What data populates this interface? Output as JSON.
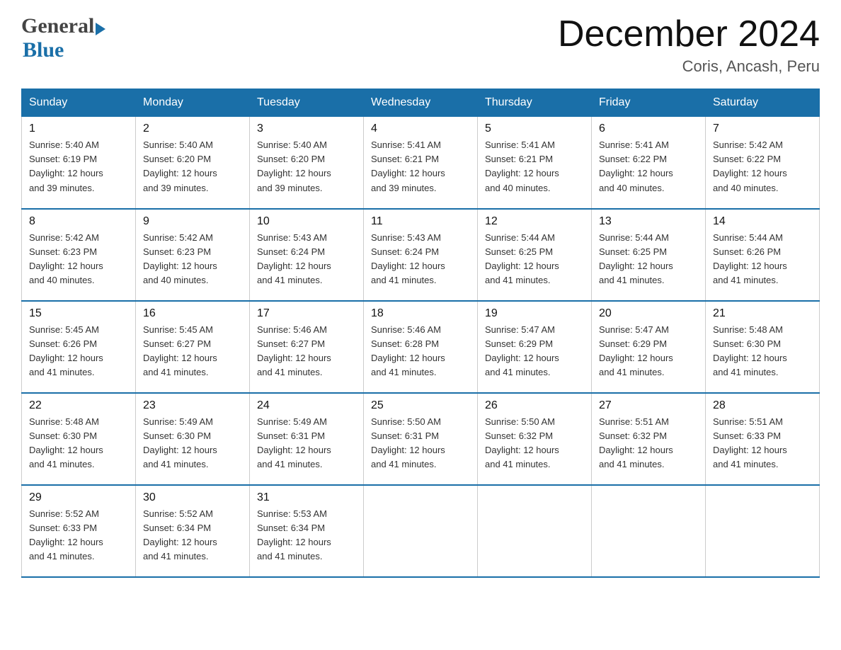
{
  "header": {
    "title": "December 2024",
    "location": "Coris, Ancash, Peru",
    "logo_general": "General",
    "logo_blue": "Blue"
  },
  "days_of_week": [
    "Sunday",
    "Monday",
    "Tuesday",
    "Wednesday",
    "Thursday",
    "Friday",
    "Saturday"
  ],
  "weeks": [
    [
      {
        "day": "1",
        "sunrise": "5:40 AM",
        "sunset": "6:19 PM",
        "daylight": "12 hours and 39 minutes."
      },
      {
        "day": "2",
        "sunrise": "5:40 AM",
        "sunset": "6:20 PM",
        "daylight": "12 hours and 39 minutes."
      },
      {
        "day": "3",
        "sunrise": "5:40 AM",
        "sunset": "6:20 PM",
        "daylight": "12 hours and 39 minutes."
      },
      {
        "day": "4",
        "sunrise": "5:41 AM",
        "sunset": "6:21 PM",
        "daylight": "12 hours and 39 minutes."
      },
      {
        "day": "5",
        "sunrise": "5:41 AM",
        "sunset": "6:21 PM",
        "daylight": "12 hours and 40 minutes."
      },
      {
        "day": "6",
        "sunrise": "5:41 AM",
        "sunset": "6:22 PM",
        "daylight": "12 hours and 40 minutes."
      },
      {
        "day": "7",
        "sunrise": "5:42 AM",
        "sunset": "6:22 PM",
        "daylight": "12 hours and 40 minutes."
      }
    ],
    [
      {
        "day": "8",
        "sunrise": "5:42 AM",
        "sunset": "6:23 PM",
        "daylight": "12 hours and 40 minutes."
      },
      {
        "day": "9",
        "sunrise": "5:42 AM",
        "sunset": "6:23 PM",
        "daylight": "12 hours and 40 minutes."
      },
      {
        "day": "10",
        "sunrise": "5:43 AM",
        "sunset": "6:24 PM",
        "daylight": "12 hours and 41 minutes."
      },
      {
        "day": "11",
        "sunrise": "5:43 AM",
        "sunset": "6:24 PM",
        "daylight": "12 hours and 41 minutes."
      },
      {
        "day": "12",
        "sunrise": "5:44 AM",
        "sunset": "6:25 PM",
        "daylight": "12 hours and 41 minutes."
      },
      {
        "day": "13",
        "sunrise": "5:44 AM",
        "sunset": "6:25 PM",
        "daylight": "12 hours and 41 minutes."
      },
      {
        "day": "14",
        "sunrise": "5:44 AM",
        "sunset": "6:26 PM",
        "daylight": "12 hours and 41 minutes."
      }
    ],
    [
      {
        "day": "15",
        "sunrise": "5:45 AM",
        "sunset": "6:26 PM",
        "daylight": "12 hours and 41 minutes."
      },
      {
        "day": "16",
        "sunrise": "5:45 AM",
        "sunset": "6:27 PM",
        "daylight": "12 hours and 41 minutes."
      },
      {
        "day": "17",
        "sunrise": "5:46 AM",
        "sunset": "6:27 PM",
        "daylight": "12 hours and 41 minutes."
      },
      {
        "day": "18",
        "sunrise": "5:46 AM",
        "sunset": "6:28 PM",
        "daylight": "12 hours and 41 minutes."
      },
      {
        "day": "19",
        "sunrise": "5:47 AM",
        "sunset": "6:29 PM",
        "daylight": "12 hours and 41 minutes."
      },
      {
        "day": "20",
        "sunrise": "5:47 AM",
        "sunset": "6:29 PM",
        "daylight": "12 hours and 41 minutes."
      },
      {
        "day": "21",
        "sunrise": "5:48 AM",
        "sunset": "6:30 PM",
        "daylight": "12 hours and 41 minutes."
      }
    ],
    [
      {
        "day": "22",
        "sunrise": "5:48 AM",
        "sunset": "6:30 PM",
        "daylight": "12 hours and 41 minutes."
      },
      {
        "day": "23",
        "sunrise": "5:49 AM",
        "sunset": "6:30 PM",
        "daylight": "12 hours and 41 minutes."
      },
      {
        "day": "24",
        "sunrise": "5:49 AM",
        "sunset": "6:31 PM",
        "daylight": "12 hours and 41 minutes."
      },
      {
        "day": "25",
        "sunrise": "5:50 AM",
        "sunset": "6:31 PM",
        "daylight": "12 hours and 41 minutes."
      },
      {
        "day": "26",
        "sunrise": "5:50 AM",
        "sunset": "6:32 PM",
        "daylight": "12 hours and 41 minutes."
      },
      {
        "day": "27",
        "sunrise": "5:51 AM",
        "sunset": "6:32 PM",
        "daylight": "12 hours and 41 minutes."
      },
      {
        "day": "28",
        "sunrise": "5:51 AM",
        "sunset": "6:33 PM",
        "daylight": "12 hours and 41 minutes."
      }
    ],
    [
      {
        "day": "29",
        "sunrise": "5:52 AM",
        "sunset": "6:33 PM",
        "daylight": "12 hours and 41 minutes."
      },
      {
        "day": "30",
        "sunrise": "5:52 AM",
        "sunset": "6:34 PM",
        "daylight": "12 hours and 41 minutes."
      },
      {
        "day": "31",
        "sunrise": "5:53 AM",
        "sunset": "6:34 PM",
        "daylight": "12 hours and 41 minutes."
      },
      null,
      null,
      null,
      null
    ]
  ],
  "labels": {
    "sunrise": "Sunrise: ",
    "sunset": "Sunset: ",
    "daylight": "Daylight: "
  },
  "colors": {
    "header_bg": "#1a6fa8",
    "header_text": "#ffffff",
    "border": "#1a6fa8",
    "text": "#333333"
  }
}
